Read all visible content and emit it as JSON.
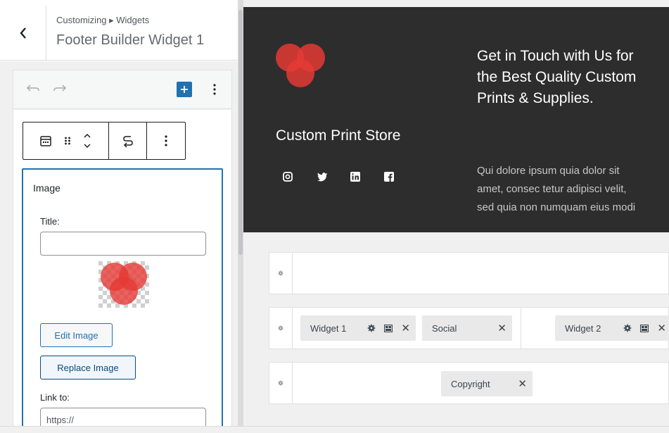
{
  "header": {
    "breadcrumb": "Customizing ▸ Widgets",
    "title": "Footer Builder Widget 1",
    "back_icon": "chevron-left-icon"
  },
  "editor_toolbar": {
    "undo_icon": "undo-icon",
    "redo_icon": "redo-icon",
    "inserter_icon": "plus-icon",
    "more_icon": "more-vertical-icon"
  },
  "block_toolbar": {
    "icons": [
      "calendar-icon",
      "drag-handle-icon",
      "move-up-down-icon",
      "transform-icon",
      "more-vertical-icon"
    ]
  },
  "widget": {
    "heading": "Image",
    "title_label": "Title:",
    "title_value": "",
    "edit_image_label": "Edit Image",
    "replace_image_label": "Replace Image",
    "link_label": "Link to:",
    "link_value": "https://"
  },
  "footer_preview": {
    "store_name": "Custom Print Store",
    "social_icons": [
      "instagram-icon",
      "twitter-icon",
      "linkedin-icon",
      "facebook-icon"
    ],
    "contact_heading": "Get in Touch with Us for the Best Quality Custom Prints & Supplies.",
    "contact_text": "Qui dolore ipsum quia dolor sit amet, consec tetur adipisci velit, sed quia non numquam eius modi"
  },
  "builder": {
    "rows": [
      {
        "chips": []
      },
      {
        "chips": [
          {
            "label": "Widget 1",
            "actions": [
              "gear-icon",
              "layout-icon",
              "close-icon"
            ]
          },
          {
            "label": "Social",
            "actions": [
              "close-icon"
            ]
          },
          {
            "label": "Widget 2",
            "actions": [
              "gear-icon",
              "layout-icon",
              "close-icon"
            ]
          }
        ]
      },
      {
        "chips": [
          {
            "label": "Copyright",
            "actions": [
              "close-icon"
            ]
          }
        ]
      }
    ],
    "close_glyph": "✕"
  },
  "colors": {
    "accent": "#2271b1",
    "footer_bg": "#2d2d2d",
    "logo_red": "#e53935"
  }
}
